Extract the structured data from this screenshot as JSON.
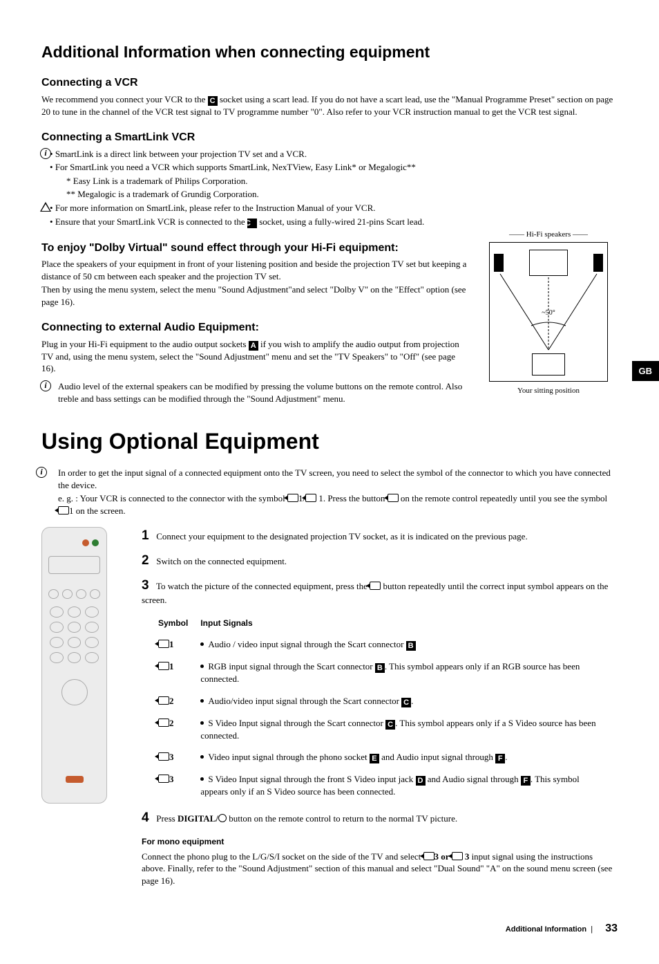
{
  "title_main": "Additional Information when connecting equipment",
  "vcr": {
    "heading": "Connecting a VCR",
    "p1_pre": "We recommend you connect your VCR to the ",
    "p1_letter": "C",
    "p1_post": " socket using a scart lead. If you do not have a scart lead, use the \"Manual Programme Preset\" section on page 20 to tune in the channel of the VCR test signal to TV programme number \"0\". Also refer to your VCR instruction manual to get the VCR test signal."
  },
  "smart": {
    "heading": "Connecting a SmartLink VCR",
    "b1": "SmartLink is a direct link between your projection TV set and a VCR.",
    "b2": "For SmartLink you need a VCR which supports SmartLink, NexTView, Easy Link* or Megalogic**",
    "b2a": "* Easy Link is a trademark of Philips Corporation.",
    "b2b": "** Megalogic is a trademark of Grundig Corporation.",
    "b3": "For more information on SmartLink, please refer to the Instruction Manual of your VCR.",
    "b4_pre": "Ensure that your SmartLink VCR is connected to the ",
    "b4_letter": "C",
    "b4_post": " socket, using a fully-wired 21-pins Scart lead."
  },
  "dolby": {
    "heading": "To enjoy \"Dolby Virtual\" sound effect through your Hi-Fi equipment:",
    "p1": "Place the speakers of your equipment in front of your listening position and beside the projection TV set but keeping a distance of 50 cm between each speaker and the projection TV set.",
    "p2": "Then by using the menu system, select the menu \"Sound Adjustment\"and select \"Dolby V\" on the \"Effect\" option (see page 16)."
  },
  "ext_audio": {
    "heading": "Connecting to external Audio Equipment:",
    "p1_pre": "Plug in your Hi-Fi equipment to the audio output sockets ",
    "p1_letter": "A",
    "p1_post": " if you wish to amplify the audio output from projection TV and, using the menu system, select the \"Sound Adjustment\" menu and set the \"TV Speakers\" to \"Off\" (see page 16).",
    "note": "Audio level of the external speakers can be modified by pressing the volume buttons on the remote control. Also treble and bass settings can be modified through the \"Sound Adjustment\" menu."
  },
  "diagram": {
    "hifi": "Hi-Fi speakers",
    "angle": "~50°",
    "sit": "Your sitting position"
  },
  "gb": "GB",
  "using": {
    "title": "Using Optional Equipment",
    "intro1": "In order to get the input signal of a connected equipment onto the TV screen, you need to select the symbol of the connector to which you have connected the device.",
    "intro2_pre": "e. g. : Your VCR is connected to the connector with the symbol ",
    "intro2_mid": "1/",
    "intro2_post": " 1. Press the button ",
    "intro2_end": " on the remote control repeatedly until you see the symbol ",
    "intro2_final": "1 on the screen."
  },
  "steps": {
    "s1": "Connect your equipment to the designated projection TV socket, as it is indicated on the previous page.",
    "s2": "Switch on the connected equipment.",
    "s3_pre": "To watch the picture of the connected equipment, press the ",
    "s3_post": " button repeatedly until the  correct input symbol appears on the screen.",
    "s4_pre": "Press ",
    "s4_bold": "DIGITAL/",
    "s4_post": " button on the remote control to return to the normal TV picture."
  },
  "symtable": {
    "h1": "Symbol",
    "h2": "Input Signals",
    "rows": [
      {
        "sym": "1",
        "txt_pre": "Audio / video input signal through the Scart connector ",
        "letter": "B",
        "txt_post": ""
      },
      {
        "sym": "1",
        "txt_pre": "RGB input signal through the Scart connector ",
        "letter": "B",
        "txt_post": ". This symbol appears only if an RGB source has been connected."
      },
      {
        "sym": "2",
        "txt_pre": "Audio/video input signal through the Scart connector ",
        "letter": "C",
        "txt_post": "."
      },
      {
        "sym": "2",
        "txt_pre": "S Video Input signal through the Scart connector ",
        "letter": "C",
        "txt_post": ". This symbol appears only if a S Video source has been connected."
      },
      {
        "sym": "3",
        "txt_pre": "Video input signal through the phono socket ",
        "letter": "E",
        "txt_post": " and Audio input signal through ",
        "letter2": "F",
        "txt_post2": "."
      },
      {
        "sym": "3",
        "txt_pre": "S Video Input signal through the front S Video input jack ",
        "letter": "D",
        "txt_post": " and Audio signal through ",
        "letter2": "F",
        "txt_post2": ". This symbol appears only if an S Video source has been connected."
      }
    ]
  },
  "mono": {
    "heading": "For mono equipment",
    "p_pre": "Connect the phono plug to the L/G/S/I socket on the side of the TV and select ",
    "p_mid": "3 or ",
    "p_mid2": "3",
    "p_post": " input signal using the instructions above. Finally, refer to the \"Sound Adjustment\" section of this manual and select \"Dual Sound\" \"A\" on the sound menu screen (see page 16)."
  },
  "footer": {
    "section": "Additional Information",
    "page": "33"
  }
}
